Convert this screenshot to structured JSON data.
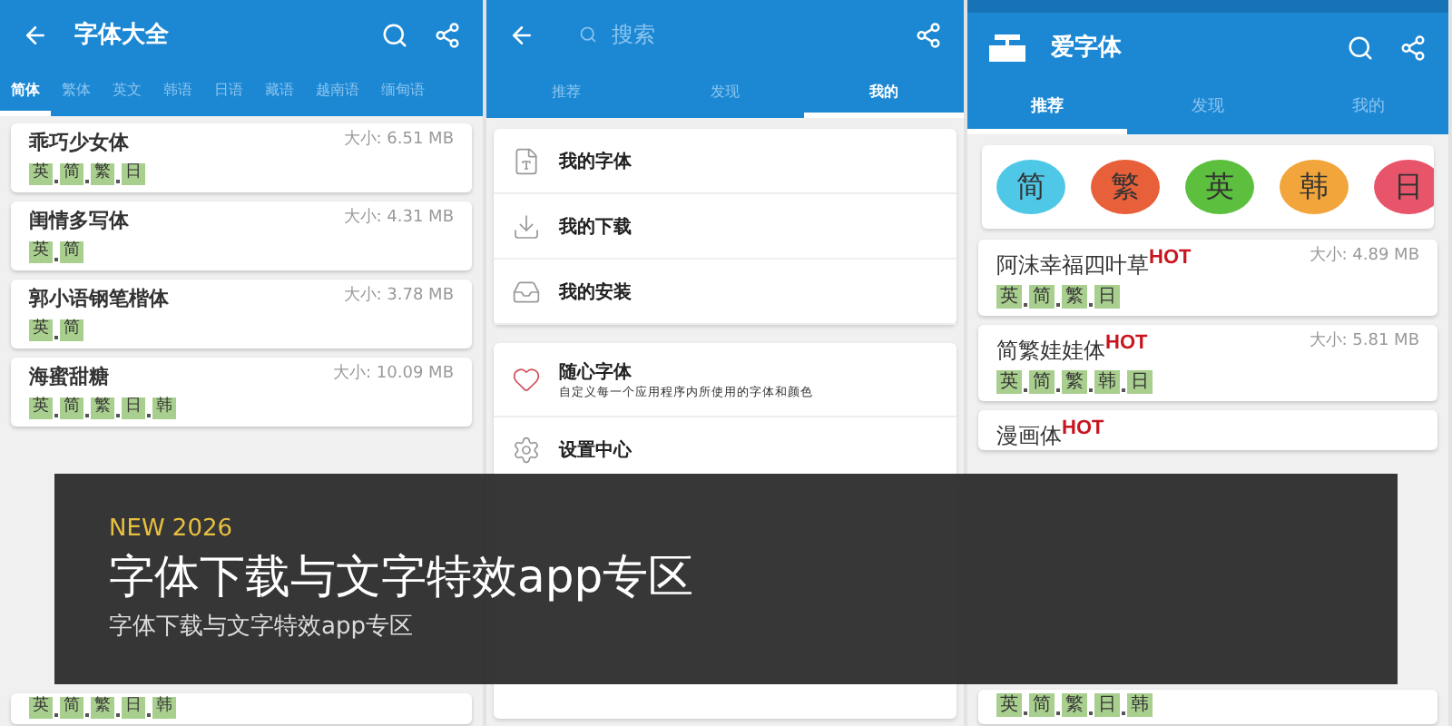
{
  "left_panel": {
    "title": "字体大全",
    "tabs": [
      {
        "label": "简体",
        "selected": true
      },
      {
        "label": "繁体",
        "selected": false
      },
      {
        "label": "英文",
        "selected": false
      },
      {
        "label": "韩语",
        "selected": false
      },
      {
        "label": "日语",
        "selected": false
      },
      {
        "label": "藏语",
        "selected": false
      },
      {
        "label": "越南语",
        "selected": false
      },
      {
        "label": "缅甸语",
        "selected": false
      }
    ],
    "fonts": [
      {
        "name": "乖巧少女体",
        "size": "大小: 6.51 MB",
        "tags": [
          "英",
          "简",
          "繁",
          "日"
        ]
      },
      {
        "name": "闺情多写体",
        "size": "大小: 4.31 MB",
        "tags": [
          "英",
          "简"
        ]
      },
      {
        "name": "郭小语钢笔楷体",
        "size": "大小: 3.78 MB",
        "tags": [
          "英",
          "简"
        ]
      },
      {
        "name": "海蜜甜糖",
        "size": "大小: 10.09 MB",
        "tags": [
          "英",
          "简",
          "繁",
          "日",
          "韩"
        ]
      }
    ],
    "last_font": {
      "tags": [
        "英",
        "简",
        "繁",
        "日",
        "韩"
      ]
    }
  },
  "middle_panel": {
    "search": {
      "placeholder": "搜索"
    },
    "tabs": [
      {
        "label": "推荐",
        "selected": false
      },
      {
        "label": "发现",
        "selected": false
      },
      {
        "label": "我的",
        "selected": true
      }
    ],
    "menu_groups": [
      [
        {
          "kind": "font-file",
          "label": "我的字体"
        },
        {
          "kind": "download",
          "label": "我的下载"
        },
        {
          "kind": "install",
          "label": "我的安装"
        }
      ],
      [
        {
          "kind": "heart",
          "label": "随心字体",
          "subtitle": "自定义每一个应用程序内所使用的字体和颜色"
        },
        {
          "kind": "gear",
          "label": "设置中心"
        }
      ]
    ]
  },
  "right_panel": {
    "title": "爱字体",
    "tabs": [
      {
        "label": "推荐",
        "selected": true
      },
      {
        "label": "发现",
        "selected": false
      },
      {
        "label": "我的",
        "selected": false
      }
    ],
    "languages": [
      {
        "label": "简",
        "color": "#4fc8e8"
      },
      {
        "label": "繁",
        "color": "#e8603a"
      },
      {
        "label": "英",
        "color": "#5cbf3e"
      },
      {
        "label": "韩",
        "color": "#f2a53a"
      },
      {
        "label": "日",
        "color": "#e8556a"
      }
    ],
    "fonts": [
      {
        "name": "阿沫幸福四叶草",
        "badge": "HOT",
        "size": "大小: 4.89 MB",
        "tags": [
          "英",
          "简",
          "繁",
          "日"
        ]
      },
      {
        "name": "简繁娃娃体",
        "badge": "HOT",
        "size": "大小: 5.81 MB",
        "tags": [
          "英",
          "简",
          "繁",
          "韩",
          "日"
        ]
      },
      {
        "name": "漫画体",
        "badge": "HOT"
      }
    ],
    "last_font": {
      "tags": [
        "英",
        "简",
        "繁",
        "日",
        "韩"
      ]
    }
  },
  "banner": {
    "tag": "NEW 2026",
    "title": "字体下载与文字特效app专区",
    "subtitle": "字体下载与文字特效app专区"
  }
}
